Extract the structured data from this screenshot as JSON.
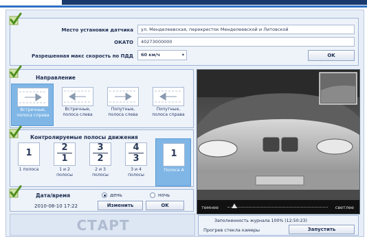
{
  "location": {
    "place_label": "Место установки датчика",
    "place_value": "ул. Менделеевская, перекресток Менделеевской и Литовской",
    "okato_label": "ОКАТО",
    "okato_value": "40273000000",
    "speed_label": "Разрешенная макс скорость по ПДД",
    "speed_value": "60 км/ч",
    "ok_label": "OK"
  },
  "direction": {
    "title": "Направление",
    "items": [
      {
        "label_line1": "Встречные,",
        "label_line2": "полоса справа",
        "active": true
      },
      {
        "label_line1": "Встречные,",
        "label_line2": "полоса слева",
        "active": false
      },
      {
        "label_line1": "Попутные,",
        "label_line2": "полоса слева",
        "active": false
      },
      {
        "label_line1": "Попутные,",
        "label_line2": "полоса справа",
        "active": false
      }
    ]
  },
  "lanes": {
    "title": "Контролируемые полосы движения",
    "items": [
      {
        "top": "1",
        "bottom": "",
        "label_line1": "1 полоса",
        "label_line2": "",
        "active": false
      },
      {
        "top": "2",
        "bottom": "1",
        "label_line1": "1 и 2",
        "label_line2": "полосы",
        "active": false
      },
      {
        "top": "3",
        "bottom": "2",
        "label_line1": "2 и 3",
        "label_line2": "полосы",
        "active": false
      },
      {
        "top": "4",
        "bottom": "3",
        "label_line1": "3 и 4",
        "label_line2": "полосы",
        "active": false
      },
      {
        "top": "1",
        "bottom": "",
        "label_line1": "Полоса А",
        "label_line2": "",
        "active": true
      }
    ]
  },
  "datetime": {
    "title": "Дата/время",
    "value": "2010-08-10 17:22",
    "day_label": "день",
    "night_label": "ночь",
    "day_selected": true,
    "change_label": "Изменить",
    "ok_label": "OK"
  },
  "camera": {
    "darker_label": "темнее",
    "lighter_label": "светлее",
    "brightness": 0.07
  },
  "start": {
    "label": "СТАРТ"
  },
  "status": {
    "journal_text": "Заполненность журнала 100% (12:50:23)",
    "heating_text": "Прогрев стекла камеры",
    "run_label": "Запустить"
  }
}
